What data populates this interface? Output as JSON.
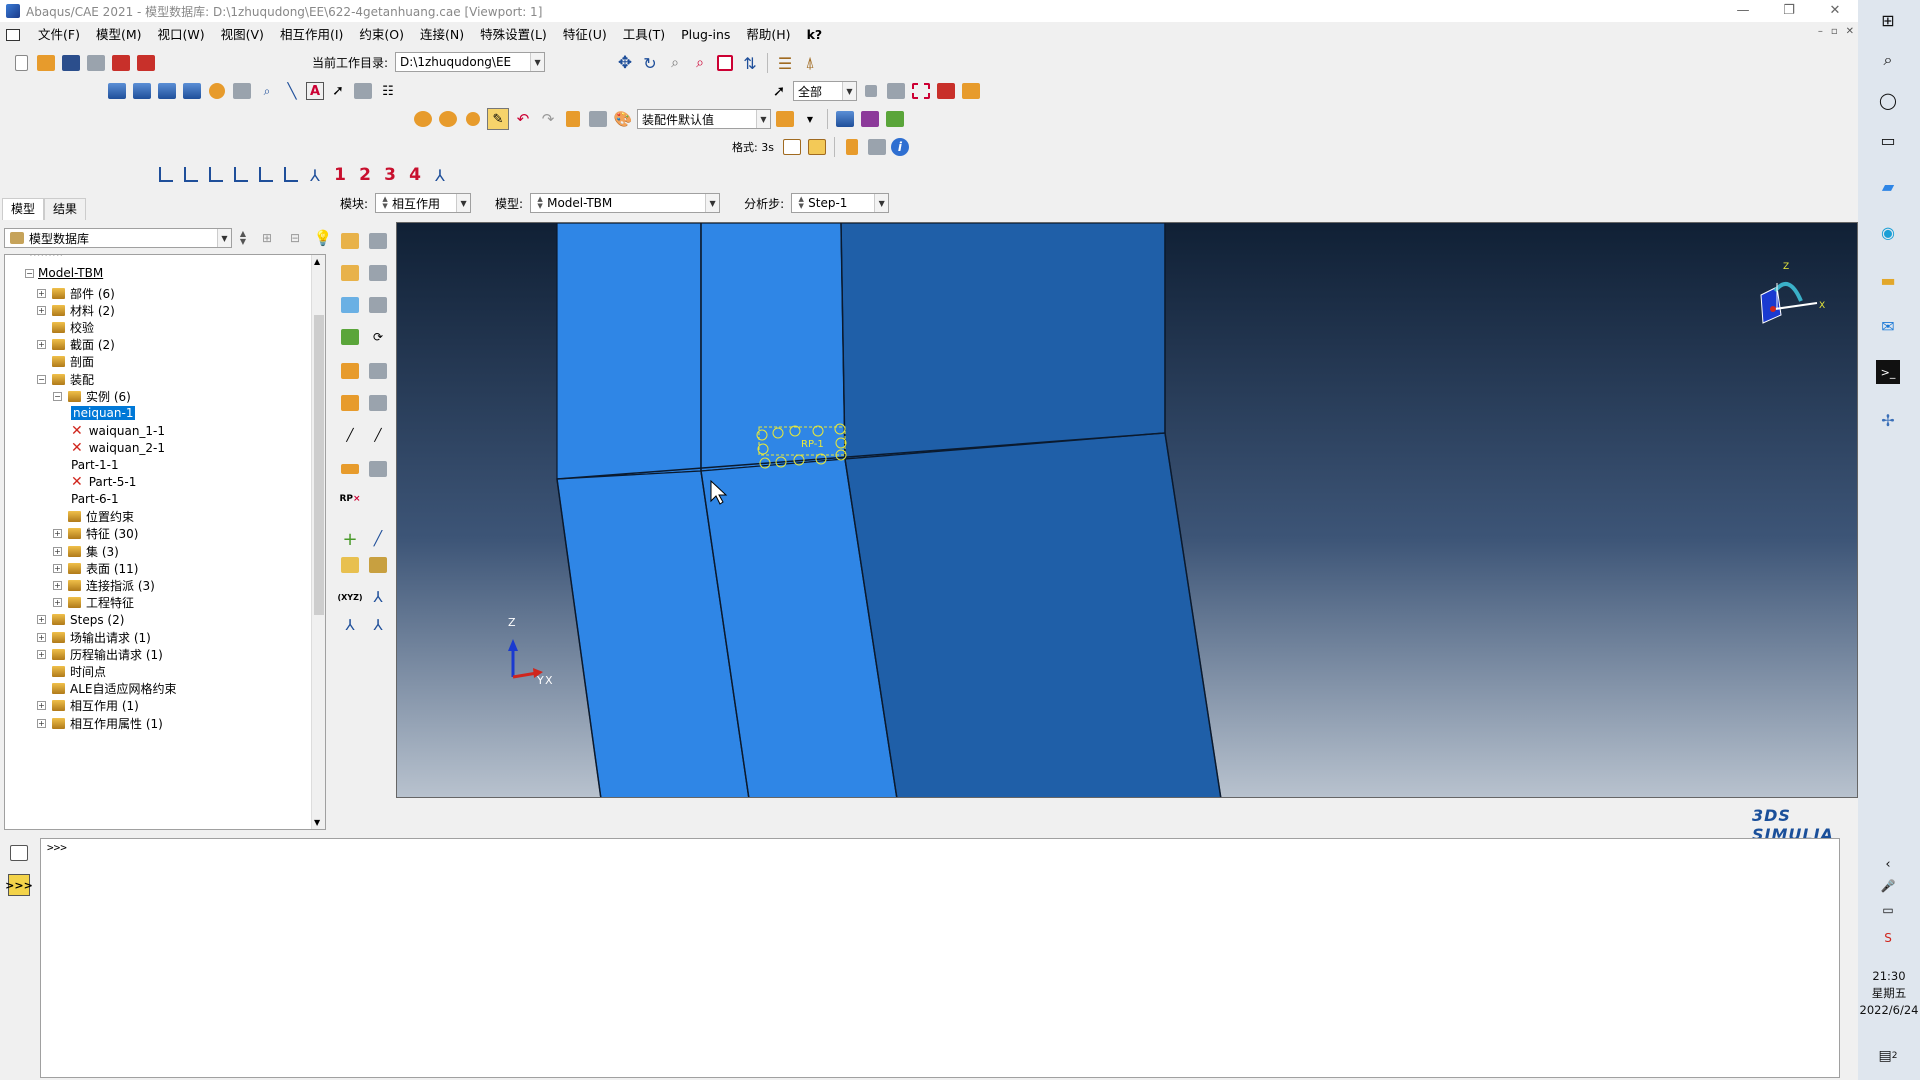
{
  "window": {
    "title": "Abaqus/CAE 2021 - 模型数据库: D:\\1zhuqudong\\EE\\622-4getanhuang.cae [Viewport: 1]",
    "controls": [
      "—",
      "❐",
      "✕"
    ],
    "mdi_controls": [
      "–",
      "▫",
      "✕"
    ]
  },
  "menu": [
    "文件(F)",
    "模型(M)",
    "视口(W)",
    "视图(V)",
    "相互作用(I)",
    "约束(O)",
    "连接(N)",
    "特殊设置(L)",
    "特征(U)",
    "工具(T)",
    "Plug-ins",
    "帮助(H)",
    "k?"
  ],
  "toolbar": {
    "workdir_label": "当前工作目录:",
    "workdir_value": "D:\\1zhuqudong\\EE",
    "select_filter": "全部",
    "assembly_display": "装配件默认值",
    "render_style_label": "格式: 3s",
    "view_numbers": [
      "1",
      "2",
      "3",
      "4"
    ]
  },
  "context_bar": {
    "module_label": "模块:",
    "module_value": "相互作用",
    "model_label": "模型:",
    "model_value": "Model-TBM",
    "step_label": "分析步:",
    "step_value": "Step-1"
  },
  "tabs": [
    "模型",
    "结果"
  ],
  "db_selector": "模型数据库",
  "tree": {
    "root": "Model-TBM",
    "items": [
      {
        "label": "部件 (6)",
        "level": 1,
        "expander": "+"
      },
      {
        "label": "材料 (2)",
        "level": 1,
        "expander": "+"
      },
      {
        "label": "校验",
        "level": 1,
        "expander": ""
      },
      {
        "label": "截面 (2)",
        "level": 1,
        "expander": "+"
      },
      {
        "label": "剖面",
        "level": 1,
        "expander": ""
      },
      {
        "label": "装配",
        "level": 1,
        "expander": "−"
      },
      {
        "label": "实例 (6)",
        "level": 2,
        "expander": "−"
      },
      {
        "label": "neiquan-1",
        "level": 3,
        "selected": true
      },
      {
        "label": "waiquan_1-1",
        "level": 3,
        "suppressed": true
      },
      {
        "label": "waiquan_2-1",
        "level": 3,
        "suppressed": true
      },
      {
        "label": "Part-1-1",
        "level": 3
      },
      {
        "label": "Part-5-1",
        "level": 3,
        "suppressed": true
      },
      {
        "label": "Part-6-1",
        "level": 3
      },
      {
        "label": "位置约束",
        "level": 2,
        "expander": ""
      },
      {
        "label": "特征 (30)",
        "level": 2,
        "expander": "+"
      },
      {
        "label": "集 (3)",
        "level": 2,
        "expander": "+"
      },
      {
        "label": "表面 (11)",
        "level": 2,
        "expander": "+"
      },
      {
        "label": "连接指派 (3)",
        "level": 2,
        "expander": "+"
      },
      {
        "label": "工程特征",
        "level": 2,
        "expander": "+"
      },
      {
        "label": "Steps (2)",
        "level": 1,
        "expander": "+"
      },
      {
        "label": "场输出请求 (1)",
        "level": 1,
        "expander": "+"
      },
      {
        "label": "历程输出请求 (1)",
        "level": 1,
        "expander": "+"
      },
      {
        "label": "时间点",
        "level": 1,
        "expander": ""
      },
      {
        "label": "ALE自适应网格约束",
        "level": 1,
        "expander": ""
      },
      {
        "label": "相互作用  (1)",
        "level": 1,
        "expander": "+"
      },
      {
        "label": "相互作用属性 (1)",
        "level": 1,
        "expander": "+"
      }
    ]
  },
  "viewport": {
    "rp_label": "RP-1",
    "triad": {
      "z": "Z",
      "y": "Y",
      "x": "X"
    },
    "mini_triad": {
      "z": "Z",
      "x": "X"
    },
    "colors": {
      "light_blue": "#2f86e6",
      "dark_blue": "#1f5fa8",
      "edge": "#0b1a2e",
      "rp": "#e8e83a"
    }
  },
  "brand": "3DS SIMULIA",
  "command": {
    "prompt": ">>>"
  },
  "clock": {
    "time": "21:30",
    "weekday": "星期五",
    "date": "2022/6/24"
  },
  "taskbar_badge": "2"
}
